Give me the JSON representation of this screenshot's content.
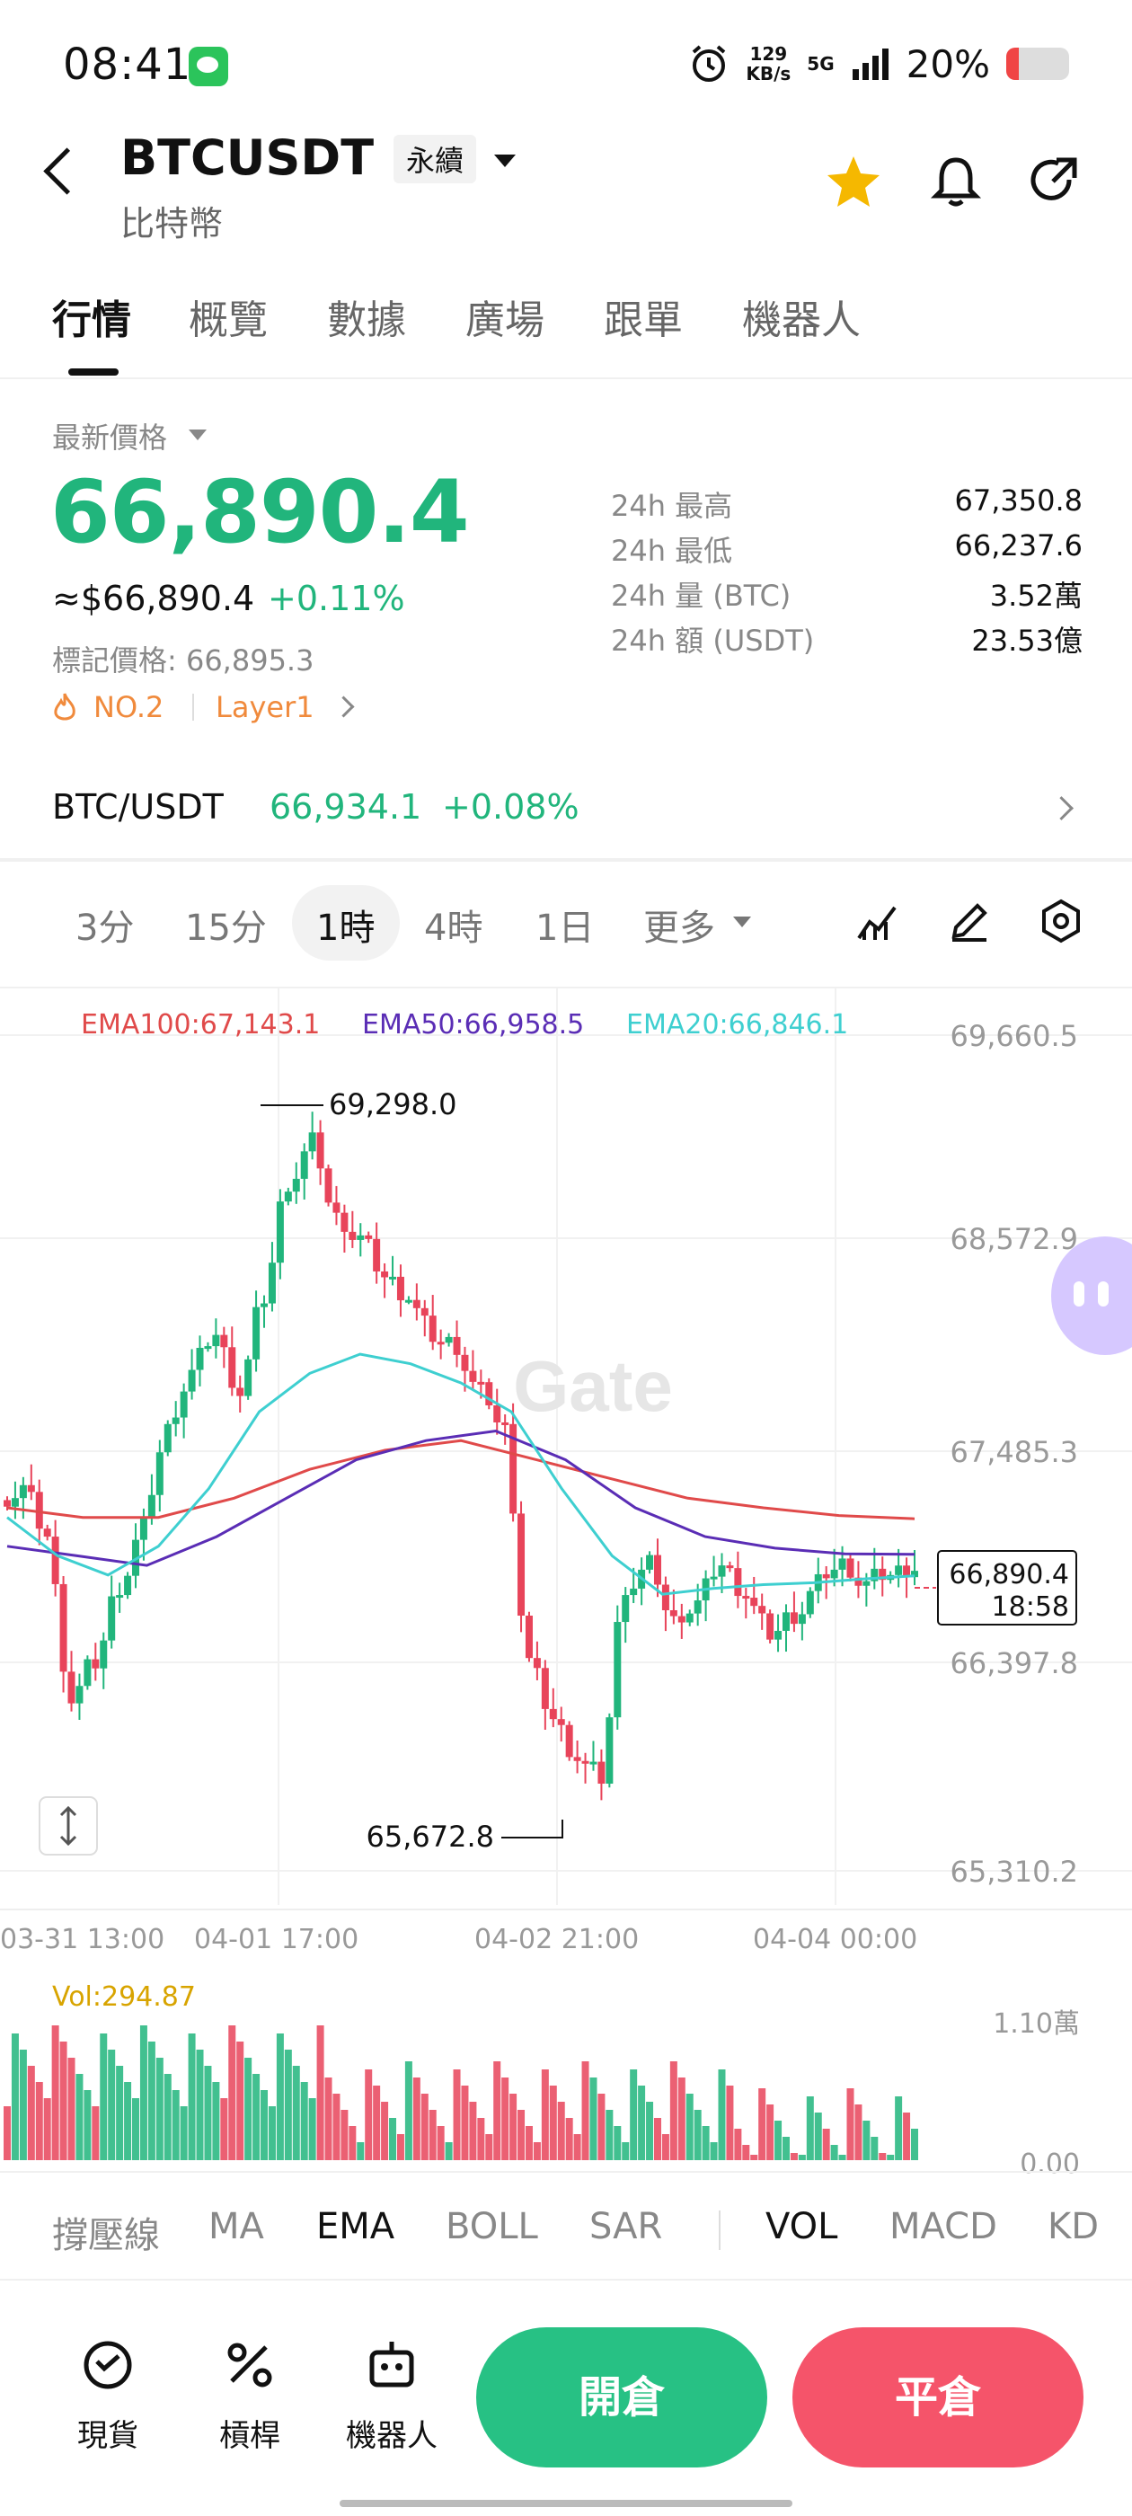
{
  "status_bar": {
    "time": "08:41",
    "net_speed_top": "129",
    "net_speed_bottom": "KB/s",
    "network": "5G",
    "battery": "20%"
  },
  "header": {
    "symbol": "BTCUSDT",
    "contract_type": "永續",
    "name": "比特幣"
  },
  "tabs": [
    "行情",
    "概覽",
    "數據",
    "廣場",
    "跟單",
    "機器人"
  ],
  "price": {
    "label": "最新價格",
    "last": "66,890.4",
    "usd_equiv": "≈$66,890.4",
    "change": "+0.11%",
    "mark_label": "標記價格: 66,895.3",
    "rank": "NO.2",
    "sector": "Layer1"
  },
  "stats": [
    {
      "label": "24h  最高",
      "value": "67,350.8"
    },
    {
      "label": "24h  最低",
      "value": "66,237.6"
    },
    {
      "label": "24h  量 (BTC)",
      "value": "3.52萬"
    },
    {
      "label": "24h  額 (USDT)",
      "value": "23.53億"
    }
  ],
  "spot": {
    "pair": "BTC/USDT",
    "price": "66,934.1",
    "change": "+0.08%"
  },
  "intervals": [
    "3分",
    "15分",
    "1時",
    "4時",
    "1日",
    "更多"
  ],
  "active_interval": "1時",
  "ema_legend": [
    {
      "label": "EMA100:67,143.1",
      "color": "#e04a4a"
    },
    {
      "label": "EMA50:66,958.5",
      "color": "#5a2db5"
    },
    {
      "label": "EMA20:66,846.1",
      "color": "#3ecfd0"
    }
  ],
  "chart_data": {
    "type": "line",
    "title": "",
    "y_ticks": [
      "69,660.5",
      "68,572.9",
      "67,485.3",
      "66,397.8",
      "65,310.2"
    ],
    "x_ticks": [
      "03-31 13:00",
      "04-01 17:00",
      "04-02 21:00",
      "04-04 00:00"
    ],
    "ylim": [
      65310.2,
      69660.5
    ],
    "high_label": "69,298.0",
    "low_label": "65,672.8",
    "last_price_tag": "66,890.4",
    "countdown": "18:58",
    "watermark": "Gate",
    "close_series": [
      67300,
      67050,
      66200,
      66400,
      66800,
      67100,
      67600,
      67900,
      68100,
      67800,
      68300,
      68900,
      69100,
      68700,
      68600,
      68400,
      68300,
      68100,
      68050,
      67800,
      67600,
      66400,
      66100,
      65900,
      65800,
      66800,
      66900,
      66600,
      66700,
      66900,
      66750,
      66550,
      66650,
      66800,
      66900,
      66800,
      66850,
      66890
    ],
    "ema20": [
      67150,
      66950,
      66850,
      67000,
      67300,
      67700,
      67900,
      68000,
      67950,
      67850,
      67700,
      67300,
      66950,
      66750,
      66780,
      66800,
      66810,
      66830,
      66846
    ],
    "ema50": [
      67000,
      66950,
      66900,
      67050,
      67250,
      67450,
      67550,
      67600,
      67450,
      67200,
      67050,
      66990,
      66960,
      66958
    ],
    "ema100": [
      67200,
      67150,
      67150,
      67250,
      67400,
      67500,
      67550,
      67450,
      67350,
      67250,
      67200,
      67160,
      67143
    ]
  },
  "volume": {
    "label": "Vol:294.87",
    "y_max": "1.10萬",
    "y_min": "0.00"
  },
  "indicator_tabs": {
    "main": [
      "撐壓線",
      "MA",
      "EMA",
      "BOLL",
      "SAR"
    ],
    "sub": [
      "VOL",
      "MACD",
      "KD"
    ],
    "active_main": "EMA",
    "active_sub": "VOL"
  },
  "bottom_nav": {
    "spot": "現貨",
    "leverage": "槓桿",
    "bot": "機器人",
    "open": "開倉",
    "close": "平倉"
  }
}
